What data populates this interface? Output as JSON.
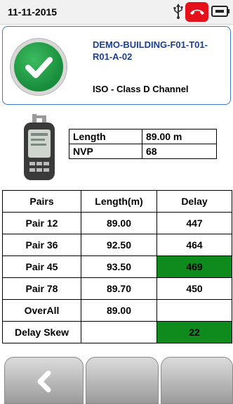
{
  "status_bar": {
    "date": "11-11-2015",
    "icons": [
      "usb-icon",
      "end-call-icon",
      "battery-icon"
    ],
    "accent_color": "#e4111b"
  },
  "result": {
    "status_icon": "pass-check-icon",
    "status_color": "#178c3b",
    "project_name": "DEMO-BUILDING-F01-T01-R01-A-02",
    "standard": "ISO - Class D Channel"
  },
  "info": {
    "rows": [
      {
        "label": "Length",
        "value": "89.00 m"
      },
      {
        "label": "NVP",
        "value": "68"
      }
    ]
  },
  "results_table": {
    "headers": [
      "Pairs",
      "Length(m)",
      "Delay"
    ],
    "rows": [
      {
        "pair": "Pair 12",
        "length": "89.00",
        "delay": "447"
      },
      {
        "pair": "Pair 36",
        "length": "92.50",
        "delay": "464"
      },
      {
        "pair": "Pair 45",
        "length": "93.50",
        "delay": "469"
      },
      {
        "pair": "Pair 78",
        "length": "89.70",
        "delay": "450"
      },
      {
        "pair": "OverAll",
        "length": "89.00",
        "delay": ""
      },
      {
        "pair": "Delay Skew",
        "length": "",
        "delay": "22"
      }
    ],
    "highlight_color": "#0f8a1c"
  },
  "buttons": {
    "back_icon": "chevron-left-icon"
  }
}
